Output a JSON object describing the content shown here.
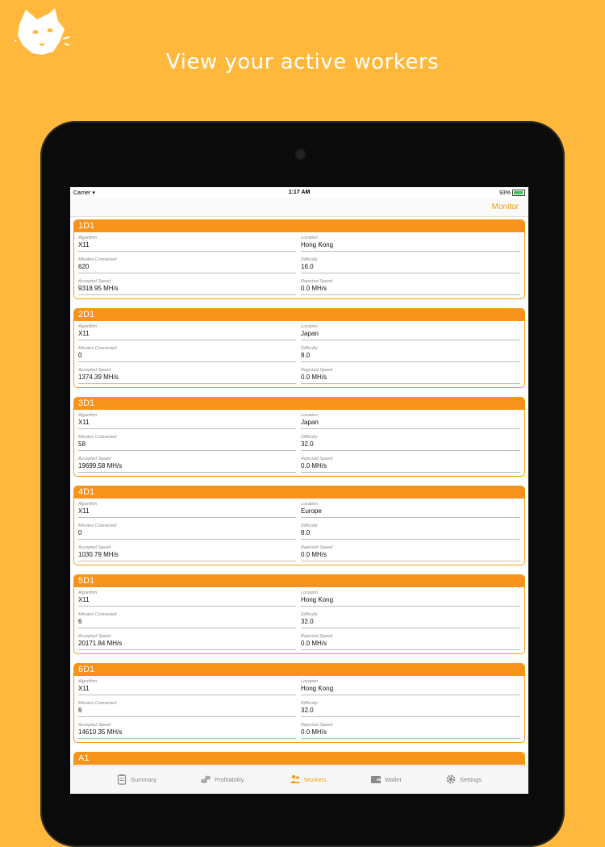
{
  "headline": "View your active workers",
  "status_bar": {
    "carrier": "Carrier",
    "time": "1:17 AM",
    "battery": "93%"
  },
  "nav": {
    "monitor_label": "Monitor"
  },
  "field_labels": {
    "algorithm": "Algorithm",
    "location": "Location",
    "minutes_connected": "Minutes Connected",
    "difficulty": "Difficulty",
    "accepted_speed": "Accepted Speed",
    "rejected_speed": "Rejected Speed"
  },
  "workers": [
    {
      "name": "1D1",
      "algorithm": "X11",
      "location": "Hong Kong",
      "minutes": "620",
      "difficulty": "16.0",
      "accepted": "9318.95 MH/s",
      "rejected": "0.0  MH/s"
    },
    {
      "name": "2D1",
      "algorithm": "X11",
      "location": "Japan",
      "minutes": "0",
      "difficulty": "8.0",
      "accepted": "1374.39 MH/s",
      "rejected": "0.0  MH/s"
    },
    {
      "name": "3D1",
      "algorithm": "X11",
      "location": "Japan",
      "minutes": "58",
      "difficulty": "32.0",
      "accepted": "19699.58 MH/s",
      "rejected": "0.0  MH/s"
    },
    {
      "name": "4D1",
      "algorithm": "X11",
      "location": "Europe",
      "minutes": "0",
      "difficulty": "8.0",
      "accepted": "1030.79 MH/s",
      "rejected": "0.0  MH/s"
    },
    {
      "name": "5D1",
      "algorithm": "X11",
      "location": "Hong Kong",
      "minutes": "6",
      "difficulty": "32.0",
      "accepted": "20171.84 MH/s",
      "rejected": "0.0  MH/s"
    },
    {
      "name": "6D1",
      "algorithm": "X11",
      "location": "Hong Kong",
      "minutes": "6",
      "difficulty": "32.0",
      "accepted": "14610.35 MH/s",
      "rejected": "0.0  MH/s"
    },
    {
      "name": "A1"
    }
  ],
  "tabs": [
    {
      "label": "Summary",
      "icon": "clipboard-icon"
    },
    {
      "label": "Profitability",
      "icon": "coins-icon"
    },
    {
      "label": "Workers",
      "icon": "workers-icon",
      "active": true
    },
    {
      "label": "Wallet",
      "icon": "wallet-icon"
    },
    {
      "label": "Settings",
      "icon": "gear-icon"
    }
  ],
  "colors": {
    "background": "#FFB83B",
    "accent": "#F7931A",
    "tab_active": "#F39C12"
  }
}
